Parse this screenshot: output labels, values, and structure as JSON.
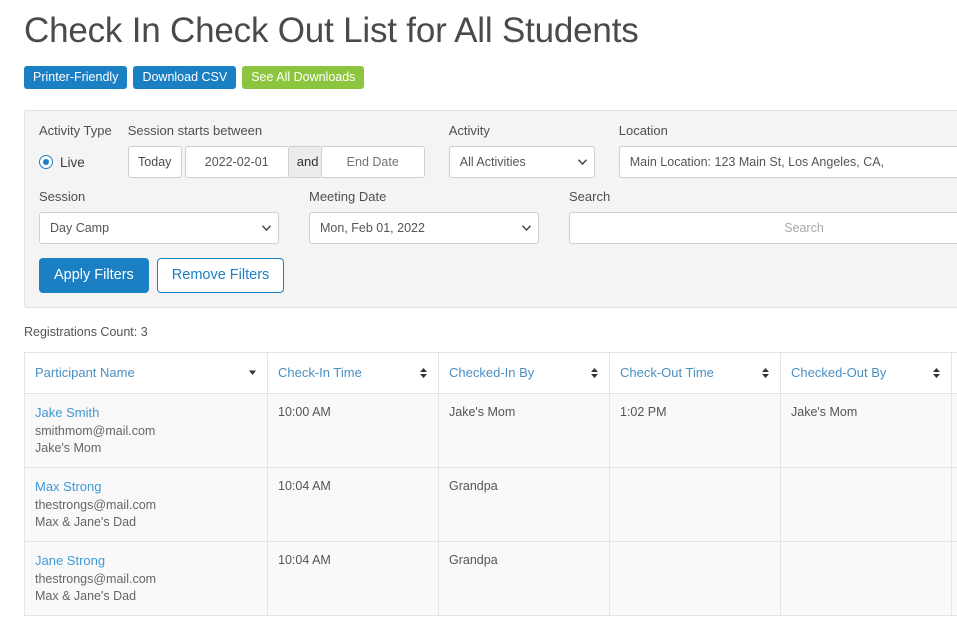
{
  "page": {
    "title": "Check In Check Out List for All Students",
    "registrations_count_label": "Registrations Count: 3"
  },
  "colors": {
    "primary_blue": "#1b7fc3",
    "green": "#8cc63e",
    "link_blue": "#3f9ad8",
    "header_link": "#4a90c2",
    "panel_bg": "#f4f4f4",
    "row_bg": "#f9f9f9"
  },
  "action_bar": {
    "printer_friendly": "Printer-Friendly",
    "download_csv": "Download CSV",
    "see_all_downloads": "See All Downloads"
  },
  "filters": {
    "activity_type": {
      "label": "Activity Type",
      "option_label": "Live",
      "checked": true
    },
    "session_starts_between": {
      "label": "Session starts between",
      "today_button": "Today",
      "start_date_value": "2022-02-01",
      "and_label": "and",
      "end_date_placeholder": "End Date",
      "end_date_value": ""
    },
    "activity": {
      "label": "Activity",
      "selected": "All Activities"
    },
    "location": {
      "label": "Location",
      "selected": "Main Location: 123 Main St, Los Angeles, CA,"
    },
    "session": {
      "label": "Session",
      "selected": "Day Camp"
    },
    "meeting_date": {
      "label": "Meeting Date",
      "selected": "Mon, Feb 01, 2022"
    },
    "search": {
      "label": "Search",
      "placeholder": "Search",
      "value": ""
    },
    "apply_button": "Apply Filters",
    "remove_button": "Remove Filters"
  },
  "table": {
    "columns": [
      {
        "label": "Participant Name",
        "sort": "desc"
      },
      {
        "label": "Check-In Time",
        "sort": "none"
      },
      {
        "label": "Checked-In By",
        "sort": "none"
      },
      {
        "label": "Check-Out Time",
        "sort": "none"
      },
      {
        "label": "Checked-Out By",
        "sort": "none"
      }
    ],
    "rows": [
      {
        "name": "Jake Smith",
        "email": "smithmom@mail.com",
        "guardian": "Jake's Mom",
        "check_in_time": "10:00 AM",
        "checked_in_by": "Jake's Mom",
        "check_out_time": "1:02 PM",
        "checked_out_by": "Jake's Mom"
      },
      {
        "name": "Max Strong",
        "email": "thestrongs@mail.com",
        "guardian": "Max & Jane's Dad",
        "check_in_time": "10:04 AM",
        "checked_in_by": "Grandpa",
        "check_out_time": "",
        "checked_out_by": ""
      },
      {
        "name": "Jane Strong",
        "email": "thestrongs@mail.com",
        "guardian": "Max & Jane's Dad",
        "check_in_time": "10:04 AM",
        "checked_in_by": "Grandpa",
        "check_out_time": "",
        "checked_out_by": ""
      }
    ]
  }
}
